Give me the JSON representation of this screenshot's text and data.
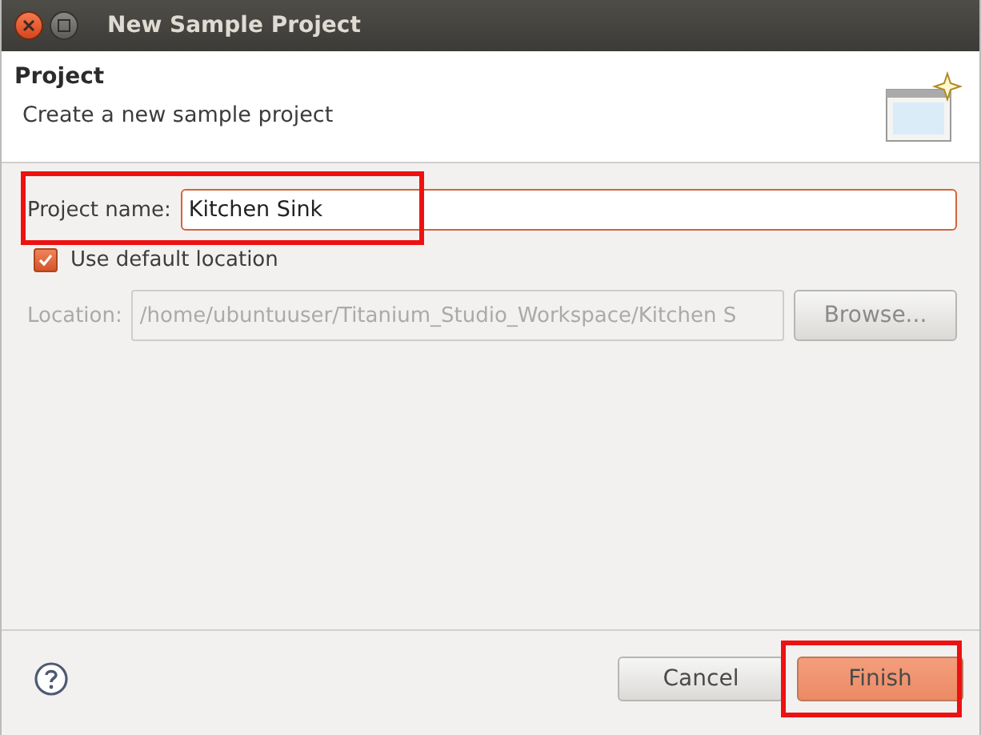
{
  "window": {
    "title": "New Sample Project"
  },
  "header": {
    "title": "Project",
    "description": "Create a new sample project"
  },
  "project_name": {
    "label": "Project name:",
    "value": "Kitchen Sink"
  },
  "default_location": {
    "label": "Use default location",
    "checked": true
  },
  "location": {
    "label": "Location:",
    "value": "/home/ubuntuuser/Titanium_Studio_Workspace/Kitchen S",
    "disabled": true,
    "browse": "Browse..."
  },
  "buttons": [
    {
      "label": "Cancel",
      "kind": "normal"
    },
    {
      "label": "Finish",
      "kind": "default"
    }
  ]
}
